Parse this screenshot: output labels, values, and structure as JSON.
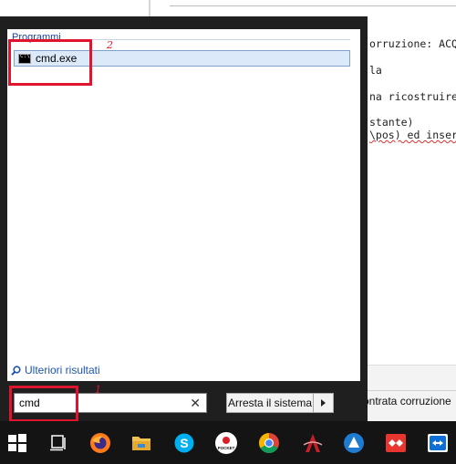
{
  "document": {
    "lines": [
      "orruzione: ACQ",
      "la",
      "na ricostruire",
      "stante)",
      "\\pos) ed inser"
    ],
    "status_text": "ontrata corruzione"
  },
  "start_menu": {
    "programs_header": "Programmi",
    "program_items": [
      {
        "label": "cmd.exe",
        "icon": "cmd-icon"
      }
    ],
    "more_results_label": "Ulteriori risultati",
    "search": {
      "value": "cmd",
      "clear_icon": "close-icon"
    },
    "shutdown_label": "Arresta il sistema",
    "shutdown_arrow_icon": "chevron-right-icon"
  },
  "annotations": [
    {
      "number": "1",
      "target": "search-box"
    },
    {
      "number": "2",
      "target": "cmd-program-item"
    }
  ],
  "taskbar": {
    "items": [
      {
        "name": "windows-start-icon",
        "color": "#ffffff"
      },
      {
        "name": "task-view-icon",
        "color": "#ffffff"
      },
      {
        "name": "firefox-icon",
        "color": "#ff7a1a"
      },
      {
        "name": "file-explorer-icon",
        "color": "#f2c14e"
      },
      {
        "name": "skype-icon",
        "color": "#00aff0"
      },
      {
        "name": "pocket-app-icon",
        "color": "#d9202b",
        "text": "POCKET"
      },
      {
        "name": "chrome-icon",
        "color": "#34a853"
      },
      {
        "name": "red-app-icon",
        "color": "#c81e2a"
      },
      {
        "name": "blue-triangle-app-icon",
        "color": "#1f7ad1"
      },
      {
        "name": "anydesk-icon",
        "color": "#e8352f"
      },
      {
        "name": "teamviewer-icon",
        "color": "#0e6fd6"
      }
    ]
  }
}
